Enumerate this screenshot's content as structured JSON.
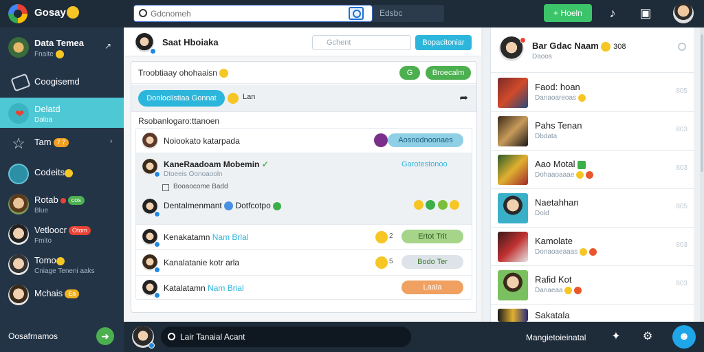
{
  "app": {
    "title": "Gosay"
  },
  "topbar": {
    "search_placeholder": "Gdcnomeh",
    "field_text": "Edsbc",
    "green_button": "+ Hoeln",
    "icons": [
      "headset-icon",
      "monitor-icon"
    ]
  },
  "sidebar": {
    "items": [
      {
        "label": "Data Temea",
        "sub": "Fnaite",
        "badge": ""
      },
      {
        "label": "Coogisemd",
        "sub": "",
        "badge": ""
      },
      {
        "label": "Delatd",
        "sub": "Daloa",
        "badge": ""
      },
      {
        "label": "Tam",
        "sub": "",
        "badge": "7 7"
      },
      {
        "label": "Codeits",
        "sub": "",
        "badge": ""
      },
      {
        "label": "Rotab",
        "sub": "Blue",
        "badge": "cos"
      },
      {
        "label": "Vetloocr",
        "sub": "Fmito",
        "badge": "Otom"
      },
      {
        "label": "Tomo",
        "sub": "Cniage Teneni aaks",
        "badge": ""
      },
      {
        "label": "Mchais",
        "sub": "",
        "badge": "Ea"
      }
    ],
    "footer": "Oosafrnamos"
  },
  "main": {
    "title": "Saat Hboiaka",
    "search_placeholder": "Gchent",
    "header_button": "Bopacitoniar",
    "card_title": "Troobtiaay ohohaaisn",
    "chip_small": "G",
    "chip_large": "Broecalm",
    "tool_button": "Donlociistiaa Gonnat",
    "tool_label": "Lan",
    "section_title": "Rsobanlogaro:ttanoen",
    "rows": [
      {
        "name": "Noiookato katarpada",
        "extra": "",
        "tag": "Aosnodnoonaes",
        "sub": "",
        "check_label": ""
      },
      {
        "name": "KaneRaadoam Mobemin",
        "extra": "",
        "tag": "Garotestonoo",
        "sub": "Dtoeeis Oonoaooln",
        "check_label": "Booaocome Badd"
      },
      {
        "name": "Dentalmenmant",
        "extra": "Dotfcotpo",
        "tag": "",
        "sub": "",
        "check_label": ""
      },
      {
        "name": "Kenakatamn",
        "extra": "Nam Brlal",
        "tag": "Ertot Trit",
        "sub": "",
        "check_label": ""
      },
      {
        "name": "Kanalatanie kotr",
        "extra": "arla",
        "tag": "Bodo Ter",
        "sub": "",
        "check_label": ""
      },
      {
        "name": "Katalatamn",
        "extra": "Nam Brial",
        "tag": "Laala",
        "sub": "",
        "check_label": ""
      }
    ],
    "row_nums": [
      "2",
      "5"
    ]
  },
  "right": {
    "title": "Bar Gdac Naam",
    "subtitle": "Daoos",
    "header_count": "308",
    "items": [
      {
        "title": "Faod: hoan",
        "sub": "Danaoareoas",
        "meta": "805"
      },
      {
        "title": "Pahs Tenan",
        "sub": "Dbdata",
        "meta": "803"
      },
      {
        "title": "Aao Motal",
        "sub": "Dohaaoaaae",
        "meta": "803"
      },
      {
        "title": "Naetahhan",
        "sub": "Dold",
        "meta": "805"
      },
      {
        "title": "Kamolate",
        "sub": "Donaoaeaaas",
        "meta": "803"
      },
      {
        "title": "Rafid Kot",
        "sub": "Danaeaa",
        "meta": "803"
      },
      {
        "title": "Sakatala",
        "sub": "",
        "meta": ""
      }
    ]
  },
  "bottombar": {
    "input_value": "Lair Tanaial Acant",
    "right_text": "Mangietoieinatal"
  },
  "colors": {
    "accent": "#2db6db",
    "green": "#4cb050",
    "sidebar": "#243447",
    "topbar": "#1e2b39"
  }
}
